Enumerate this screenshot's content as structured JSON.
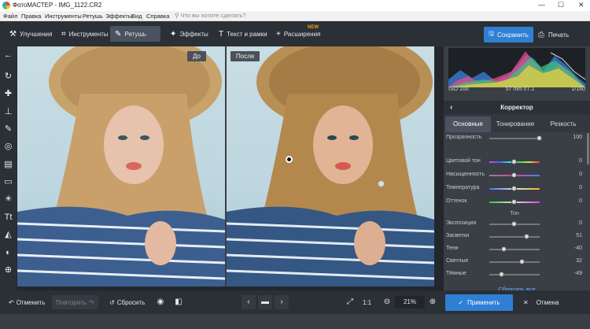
{
  "window": {
    "title": "ФотоМАСТЕР - IMG_1122.CR2",
    "minimize": "—",
    "maximize": "☐",
    "close": "✕"
  },
  "menu": {
    "items": [
      "Файл",
      "Правка",
      "Инструменты",
      "Ретушь",
      "Эффекты",
      "Вид",
      "Справка"
    ],
    "search_placeholder": "Что вы хотите сделать?"
  },
  "toolbar": {
    "tabs": [
      {
        "label": "Улучшения",
        "icon": "wand-icon"
      },
      {
        "label": "Инструменты",
        "icon": "crop-icon"
      },
      {
        "label": "Ретушь",
        "icon": "brush-icon",
        "active": true
      },
      {
        "label": "Эффекты",
        "icon": "magic-icon"
      },
      {
        "label": "Текст и рамки",
        "icon": "text-icon"
      },
      {
        "label": "Расширения",
        "icon": "plus-icon",
        "badge": "NEW"
      }
    ],
    "save_label": "Сохранить",
    "print_label": "Печать"
  },
  "canvas": {
    "before_label": "До",
    "after_label": "После"
  },
  "histogram": {
    "iso": "ISO 100",
    "lens": "57 mm f/7.1",
    "shutter": "1/160"
  },
  "corrector": {
    "title": "Корректор",
    "tabs": [
      "Основные",
      "Тонирование",
      "Резкость"
    ],
    "active_tab": "Основные",
    "transparency": {
      "label": "Прозрачность",
      "value": "100",
      "level": 1.0
    },
    "color_sliders": [
      {
        "label": "Цветовой тон",
        "value": "0",
        "level": 0.5
      },
      {
        "label": "Насыщенность",
        "value": "0",
        "level": 0.5
      },
      {
        "label": "Температура",
        "value": "0",
        "level": 0.5
      },
      {
        "label": "Оттенок",
        "value": "0",
        "level": 0.5
      }
    ],
    "tone_section": "Тон",
    "tone_sliders": [
      {
        "label": "Экспозиция",
        "value": "0",
        "level": 0.5
      },
      {
        "label": "Засветки",
        "value": "51",
        "level": 0.75
      },
      {
        "label": "Тени",
        "value": "-40",
        "level": 0.3
      },
      {
        "label": "Светлые",
        "value": "32",
        "level": 0.66
      },
      {
        "label": "Тёмные",
        "value": "-49",
        "level": 0.25
      }
    ],
    "reset_all": "Сбросить все"
  },
  "bottom": {
    "undo": "Отменить",
    "redo": "Повторить",
    "reset": "Сбросить",
    "zoom_fit": "1:1",
    "zoom_level": "21%",
    "apply": "Применить",
    "cancel": "Отмена"
  },
  "colors": {
    "accent": "#2f7fd5",
    "badge": "#f39c12",
    "link": "#6fb2ff"
  }
}
